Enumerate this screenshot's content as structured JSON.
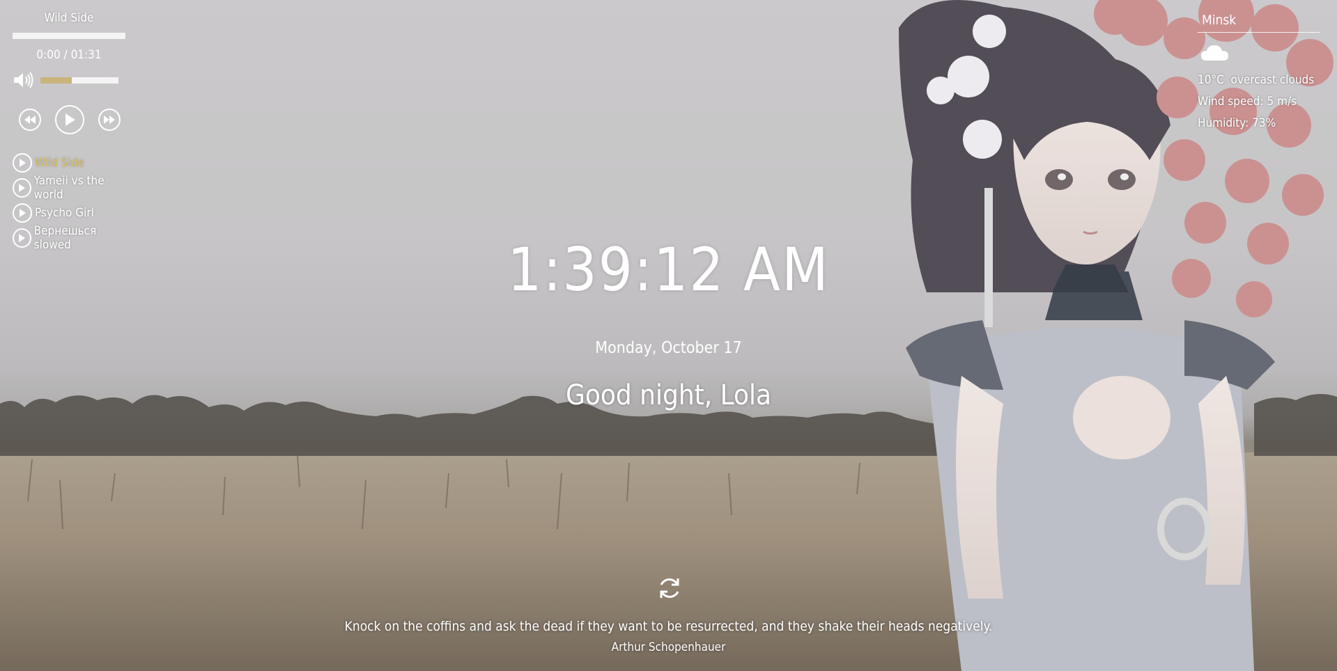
{
  "player": {
    "track_title": "Wild Side",
    "time": "0:00 / 01:31",
    "progress_fraction": 0.0,
    "volume_fraction": 0.4,
    "accent_color": "#c9b47a",
    "volume_icon": "volume-high-icon",
    "controls": {
      "prev_icon": "rewind-icon",
      "play_icon": "play-icon",
      "next_icon": "fast-forward-icon"
    },
    "playlist": [
      {
        "label": "Wild Side",
        "active": true
      },
      {
        "label": "Yameii vs the world",
        "active": false
      },
      {
        "label": "Psycho Girl",
        "active": false
      },
      {
        "label": "Вернешься slowed",
        "active": false
      }
    ],
    "active_color": "#d8c068"
  },
  "weather": {
    "city": "Minsk",
    "icon": "cloud-icon",
    "temperature": "10°C",
    "description": "overcast clouds",
    "wind": "Wind speed: 5 m/s",
    "humidity": "Humidity: 73%"
  },
  "clock": {
    "time": "1:39:12 AM",
    "date": "Monday, October 17"
  },
  "greeting": {
    "prefix": "Good night,",
    "name": "Lola"
  },
  "quote": {
    "refresh_icon": "refresh-icon",
    "text": "Knock on the coffins and ask the dead if they want to be resurrected, and they shake their heads negatively.",
    "author": "Arthur Schopenhauer"
  }
}
